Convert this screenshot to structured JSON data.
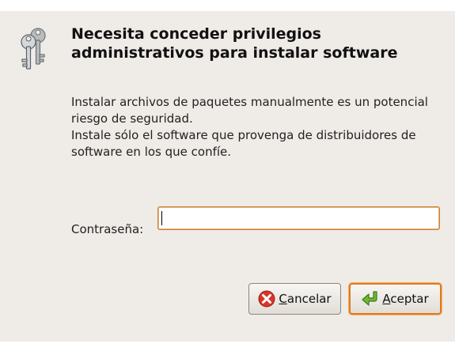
{
  "dialog": {
    "icon": "keys-icon",
    "title_line1": "Necesita conceder privilegios",
    "title_line2": "administrativos para instalar software",
    "message_line1": "Instalar archivos de paquetes manualmente es un potencial",
    "message_line2": "riesgo de seguridad.",
    "message_line3": "Instale sólo el software que provenga de distribuidores de",
    "message_line4": "software en los que confíe."
  },
  "password": {
    "label": "Contraseña:",
    "value": ""
  },
  "buttons": {
    "cancel": {
      "mnemonic": "C",
      "rest": "ancelar",
      "icon": "cancel-icon"
    },
    "accept": {
      "mnemonic": "A",
      "rest": "ceptar",
      "icon": "enter-arrow-icon"
    }
  },
  "colors": {
    "dialog_background": "#efebe7",
    "focus_accent": "#e07a1f",
    "cancel_icon_red": "#d8352a",
    "accept_icon_green": "#5fa32a"
  }
}
